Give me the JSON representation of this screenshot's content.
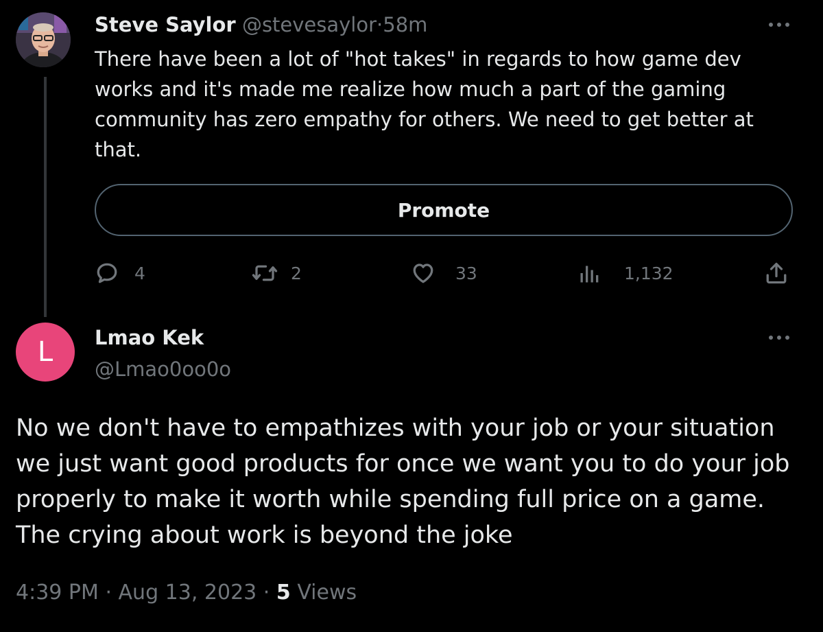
{
  "tweet": {
    "author_name": "Steve Saylor",
    "author_handle": "@stevesaylor",
    "separator": "·",
    "time_ago": "58m",
    "text": "There have been a lot of \"hot takes\" in regards to how game dev works and it's made me realize how much a part of the gaming community has zero empathy for others. We need to get better at that.",
    "promote_label": "Promote",
    "replies": "4",
    "retweets": "2",
    "likes": "33",
    "views": "1,132"
  },
  "reply": {
    "avatar_letter": "L",
    "avatar_color": "#e8457a",
    "author_name": "Lmao Kek",
    "author_handle": "@Lmao0oo0o",
    "text": "No we don't have to empathizes with your job or your situation we just want good products for once we want you to do your job properly to make it worth while spending full price on a game. The crying about work is beyond the joke",
    "time": "4:39 PM",
    "separator": "·",
    "date": "Aug 13, 2023",
    "separator2": "·",
    "views_count": "5",
    "views_label": "Views"
  },
  "icons": {
    "more": "more-horizontal-icon",
    "reply": "reply-icon",
    "retweet": "retweet-icon",
    "like": "heart-icon",
    "views": "analytics-icon",
    "share": "share-icon"
  },
  "colors": {
    "background": "#000000",
    "text_primary": "#e7e9ea",
    "text_secondary": "#71767b",
    "border": "#536471"
  }
}
